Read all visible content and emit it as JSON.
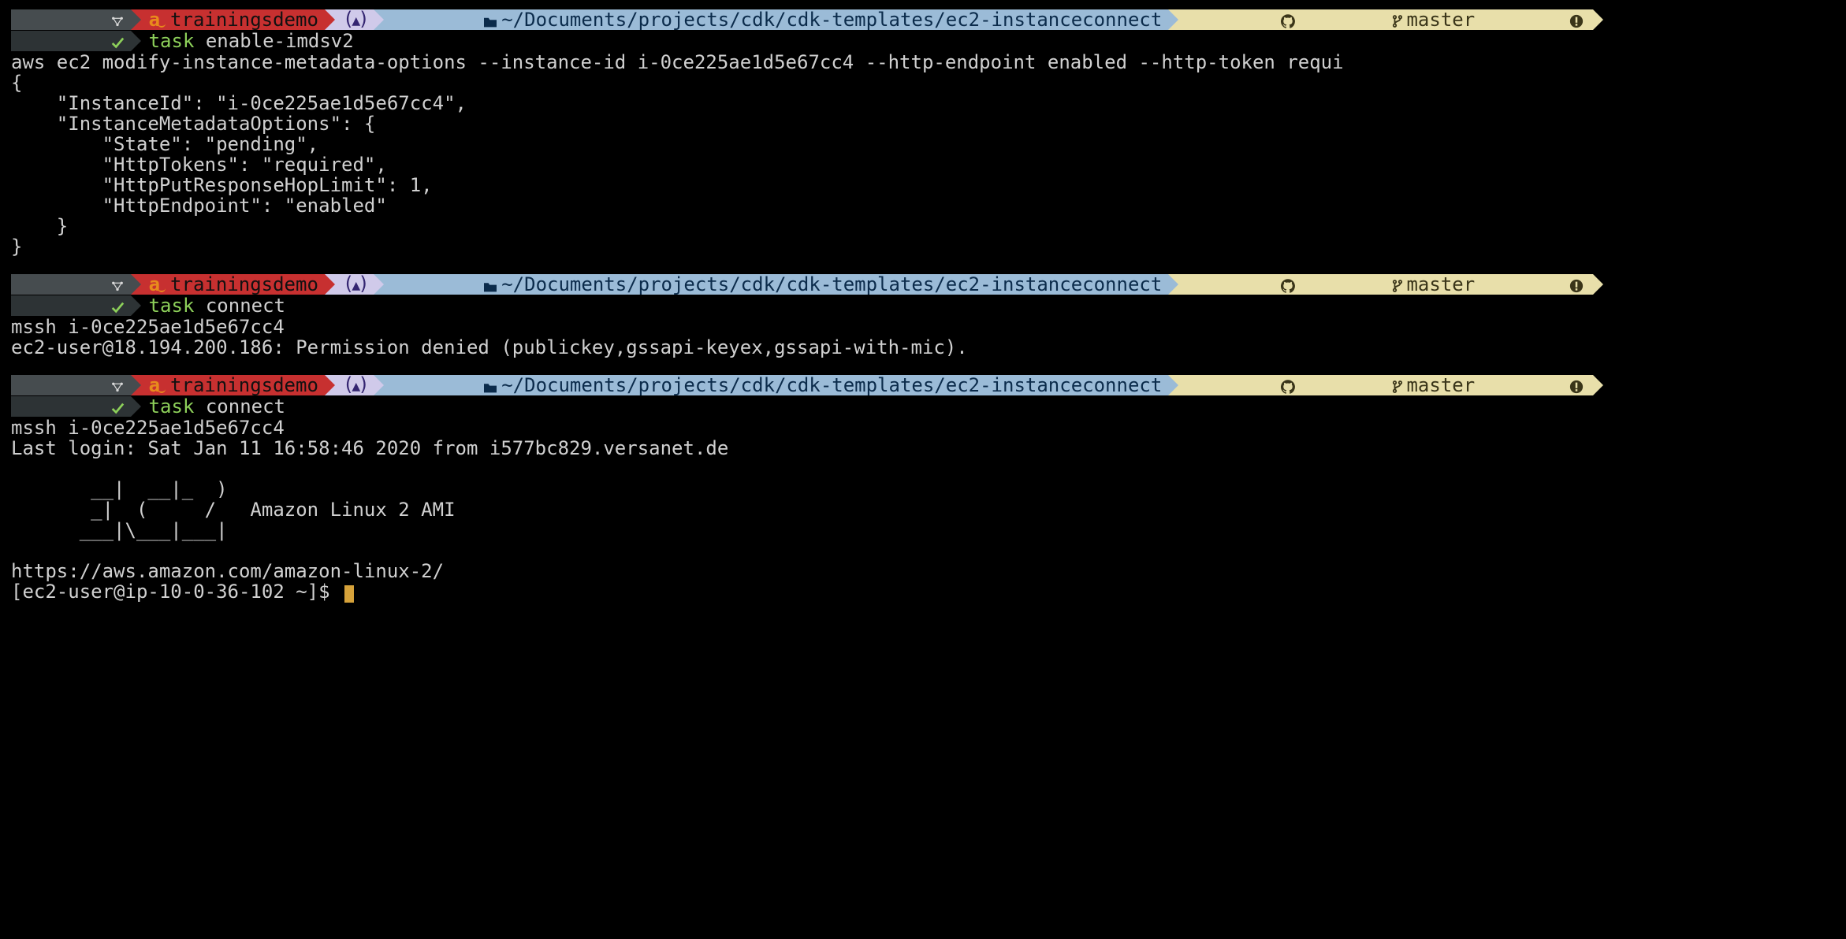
{
  "prompt": {
    "aws_profile": "trainingsdemo",
    "env_segment": "⬢",
    "path": "~/Documents/projects/cdk/cdk-templates/ec2-instanceconnect",
    "branch": "master"
  },
  "block1": {
    "command_task": "task",
    "command_args": "enable-imdsv2",
    "output": "aws ec2 modify-instance-metadata-options --instance-id i-0ce225ae1d5e67cc4 --http-endpoint enabled --http-token requi\n{\n    \"InstanceId\": \"i-0ce225ae1d5e67cc4\",\n    \"InstanceMetadataOptions\": {\n        \"State\": \"pending\",\n        \"HttpTokens\": \"required\",\n        \"HttpPutResponseHopLimit\": 1,\n        \"HttpEndpoint\": \"enabled\"\n    }\n}"
  },
  "block2": {
    "command_task": "task",
    "command_args": "connect",
    "output": "mssh i-0ce225ae1d5e67cc4\nec2-user@18.194.200.186: Permission denied (publickey,gssapi-keyex,gssapi-with-mic)."
  },
  "block3": {
    "command_task": "task",
    "command_args": "connect",
    "output": "mssh i-0ce225ae1d5e67cc4\nLast login: Sat Jan 11 16:58:46 2020 from i577bc829.versanet.de\n\n       __|  __|_  )\n       _|  (     /   Amazon Linux 2 AMI\n      ___|\\___|___|\n\nhttps://aws.amazon.com/amazon-linux-2/\n[ec2-user@ip-10-0-36-102 ~]$ "
  }
}
